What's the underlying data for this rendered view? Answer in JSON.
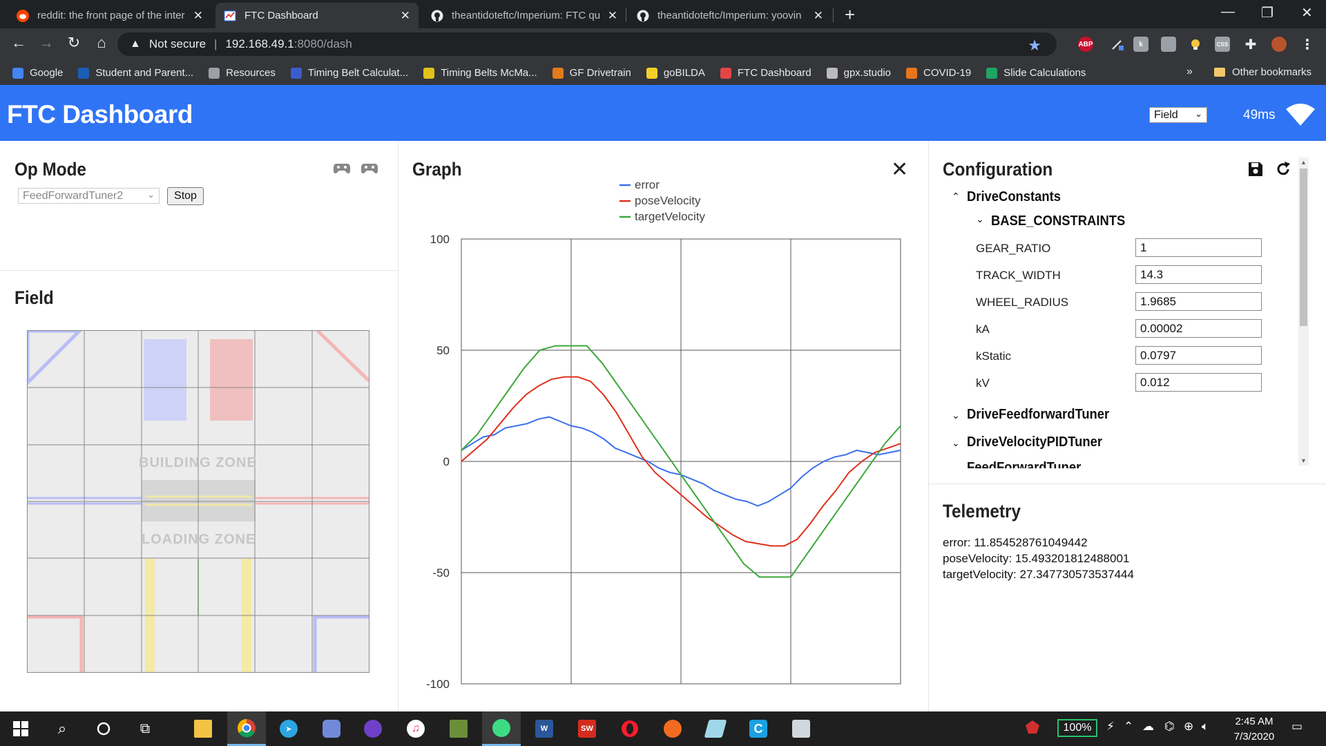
{
  "browser": {
    "tabs": [
      {
        "title": "reddit: the front page of the inter",
        "active": false
      },
      {
        "title": "FTC Dashboard",
        "active": true
      },
      {
        "title": "theantidoteftc/Imperium: FTC qu",
        "active": false
      },
      {
        "title": "theantidoteftc/Imperium: yoovin",
        "active": false
      }
    ],
    "omnibox": {
      "security": "Not secure",
      "host": "192.168.49.1",
      "path": ":8080/dash"
    },
    "bookmarks": [
      {
        "label": "Google",
        "icon": "google-icon",
        "color": "#4285f4"
      },
      {
        "label": "Student and Parent...",
        "icon": "p-icon",
        "color": "#1a5fb4"
      },
      {
        "label": "Resources",
        "icon": "globe-icon",
        "color": "#9aa0a6"
      },
      {
        "label": "Timing Belt Calculat...",
        "icon": "calculator-icon",
        "color": "#3b5ccc"
      },
      {
        "label": "Timing Belts McMa...",
        "icon": "mcmaster-icon",
        "color": "#e3c21b"
      },
      {
        "label": "GF Drivetrain",
        "icon": "gf-icon",
        "color": "#e37a1b"
      },
      {
        "label": "goBILDA",
        "icon": "gobilda-icon",
        "color": "#f2d028"
      },
      {
        "label": "FTC Dashboard",
        "icon": "dashboard-icon",
        "color": "#e24545"
      },
      {
        "label": "gpx.studio",
        "icon": "gear-icon",
        "color": "#bbbbbb"
      },
      {
        "label": "COVID-19",
        "icon": "flame-icon",
        "color": "#e8751a"
      },
      {
        "label": "Slide Calculations",
        "icon": "sheets-icon",
        "color": "#1fa463"
      }
    ],
    "bookmarks_more": "»",
    "other_bookmarks": "Other bookmarks"
  },
  "app": {
    "title": "FTC Dashboard",
    "layout_selected": "Field",
    "latency": "49ms"
  },
  "opmode": {
    "title": "Op Mode",
    "selected": "FeedForwardTuner2",
    "stop_label": "Stop"
  },
  "field": {
    "title": "Field",
    "building_zone": "BUILDING ZONE",
    "loading_zone": "LOADING ZONE"
  },
  "graph": {
    "title": "Graph",
    "close": "✕"
  },
  "chart_data": {
    "type": "line",
    "title": "",
    "xlabel": "",
    "ylabel": "",
    "ylim": [
      -100,
      100
    ],
    "yticks": [
      100,
      50,
      0,
      -50,
      -100
    ],
    "legend_position": "top-center",
    "grid": true,
    "x": [
      0,
      0.5,
      1,
      1.5,
      2,
      2.5,
      3,
      3.5,
      4,
      4.5,
      5,
      5.5,
      6,
      6.5,
      7,
      7.5,
      8,
      8.5,
      9,
      9.5,
      10,
      10.5,
      11,
      11.5,
      12,
      12.5,
      13,
      13.5,
      14,
      14.5,
      15,
      15.5,
      16,
      16.5,
      17,
      17.5,
      18,
      18.5,
      19,
      19.5,
      20
    ],
    "series": [
      {
        "name": "error",
        "color": "#3b6ff0",
        "values": [
          5,
          8,
          11,
          12,
          15,
          16,
          17,
          19,
          20,
          18,
          16,
          15,
          13,
          10,
          6,
          4,
          2,
          0,
          -3,
          -5,
          -6,
          -8,
          -10,
          -13,
          -15,
          -17,
          -18,
          -20,
          -18,
          -15,
          -12,
          -7,
          -3,
          0,
          2,
          3,
          5,
          4,
          3,
          4,
          5
        ]
      },
      {
        "name": "poseVelocity",
        "color": "#e0301e",
        "values": [
          0,
          5,
          10,
          17,
          24,
          30,
          34,
          37,
          38,
          38,
          36,
          30,
          22,
          12,
          2,
          -5,
          -10,
          -15,
          -20,
          -25,
          -29,
          -33,
          -36,
          -37,
          -38,
          -38,
          -35,
          -28,
          -20,
          -13,
          -5,
          0,
          4,
          6,
          8
        ]
      },
      {
        "name": "targetVelocity",
        "color": "#3aa83a",
        "values": [
          5,
          12,
          22,
          32,
          42,
          50,
          52,
          52,
          52,
          44,
          34,
          24,
          14,
          4,
          -6,
          -16,
          -26,
          -36,
          -46,
          -52,
          -52,
          -52,
          -42,
          -32,
          -22,
          -12,
          -2,
          8,
          16
        ]
      }
    ]
  },
  "config": {
    "title": "Configuration",
    "root": "DriveConstants",
    "group": "BASE_CONSTRAINTS",
    "rows": [
      {
        "label": "GEAR_RATIO",
        "value": "1"
      },
      {
        "label": "TRACK_WIDTH",
        "value": "14.3"
      },
      {
        "label": "WHEEL_RADIUS",
        "value": "1.9685"
      },
      {
        "label": "kA",
        "value": "0.00002"
      },
      {
        "label": "kStatic",
        "value": "0.0797"
      },
      {
        "label": "kV",
        "value": "0.012"
      }
    ],
    "nodes": [
      "DriveFeedforwardTuner",
      "DriveVelocityPIDTuner",
      "FeedForwardTuner"
    ]
  },
  "telemetry": {
    "title": "Telemetry",
    "lines": [
      "error: 11.854528761049442",
      "poseVelocity: 15.493201812488001",
      "targetVelocity: 27.347730573537444"
    ]
  },
  "taskbar": {
    "battery": "100%",
    "time": "2:45 AM",
    "date": "7/3/2020"
  }
}
